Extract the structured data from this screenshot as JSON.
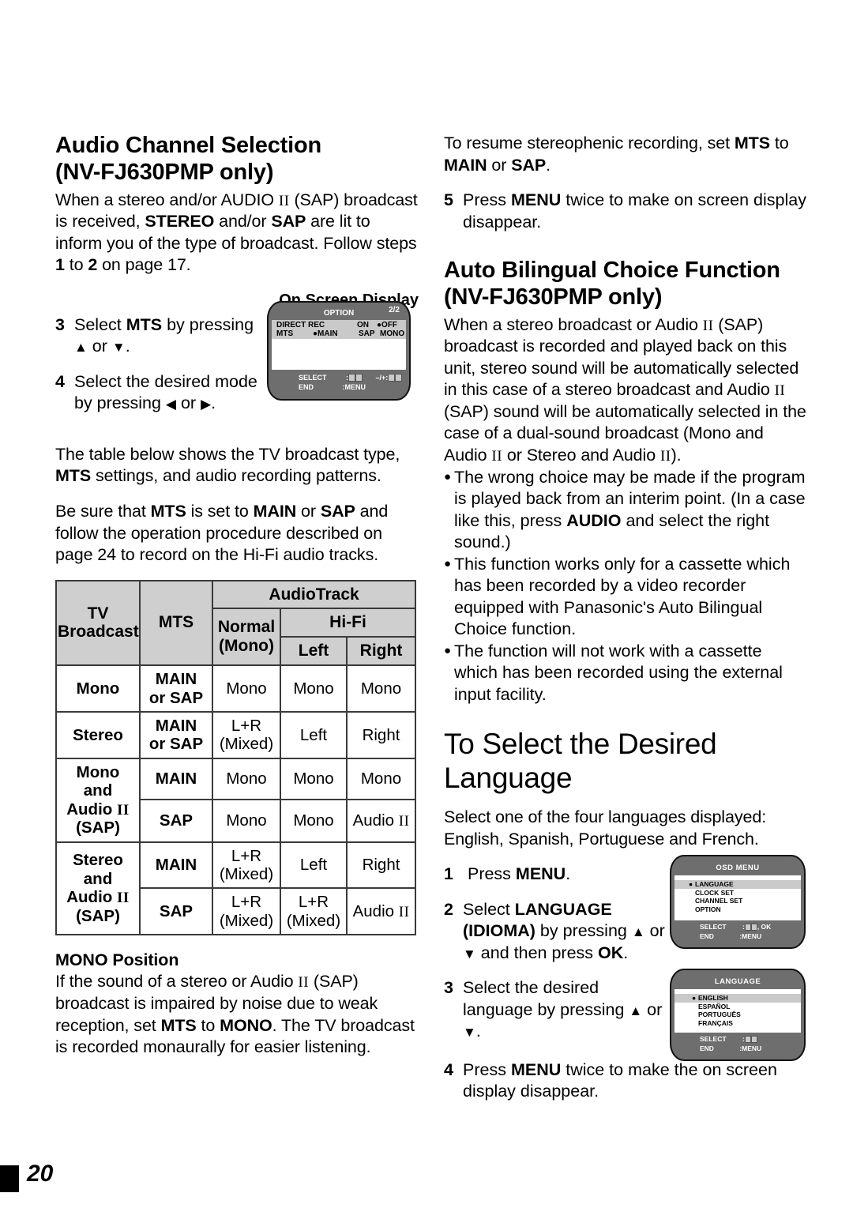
{
  "page": {
    "number": "20"
  },
  "left_column": {
    "heading": {
      "line1": "Audio Channel Selection",
      "line2": "(NV-FJ630PMP only)"
    },
    "intro": "When a stereo and/or AUDIO II (SAP) broadcast is received, STEREO and/or SAP are lit to inform you of the type of broadcast. Follow steps 1 to 2 on page 17.",
    "osd_caption": "On Screen Display",
    "steps": [
      {
        "num": "3",
        "text": "Select MTS by pressing ▲ or ▼."
      },
      {
        "num": "4",
        "text": "Select the desired mode by pressing ◀ or ▶."
      }
    ],
    "para_table_intro": "The table below shows the TV broadcast type, MTS settings, and audio recording patterns.",
    "para_besure": "Be sure that MTS is set to MAIN or SAP and follow the operation procedure described on page 24 to record on the Hi-Fi audio tracks.",
    "mono_position": {
      "heading": "MONO Position",
      "text": "If the sound of a stereo or Audio II (SAP) broadcast is impaired by noise due to weak reception, set MTS to MONO. The TV broadcast is recorded monaurally for easier listening."
    }
  },
  "osd_option": {
    "title": "OPTION",
    "page_indicator": "2/2",
    "row1": {
      "label": "DIRECT REC",
      "opt_on": "ON",
      "opt_off": "OFF",
      "selected": "OFF"
    },
    "row2": {
      "label": "MTS",
      "opt_main": "MAIN",
      "opt_sap": "SAP",
      "opt_mono": "MONO",
      "selected": "MAIN"
    },
    "footer": {
      "select_label": "SELECT",
      "select_value": ":",
      "adjust_label": "–/+:",
      "end_label": "END",
      "end_value": ":MENU"
    }
  },
  "table": {
    "header": {
      "audio_track": "AudioTrack",
      "tv_broadcast_l1": "TV",
      "tv_broadcast_l2": "Broadcast",
      "mts": "MTS",
      "normal_l1": "Normal",
      "normal_l2": "(Mono)",
      "hifi": "Hi-Fi",
      "left": "Left",
      "right": "Right"
    },
    "rows": [
      {
        "broadcast": "Mono",
        "mts_l1": "MAIN",
        "mts_l2": "or SAP",
        "normal_l1": "Mono",
        "normal_l2": "",
        "left_l1": "Mono",
        "left_l2": "",
        "right": "Mono"
      },
      {
        "broadcast": "Stereo",
        "mts_l1": "MAIN",
        "mts_l2": "or SAP",
        "normal_l1": "L+R",
        "normal_l2": "(Mixed)",
        "left_l1": "Left",
        "left_l2": "",
        "right": "Right"
      },
      {
        "broadcast_l1": "Mono",
        "broadcast_l2": "and",
        "broadcast_l3": "Audio II",
        "broadcast_l4": "(SAP)",
        "mts_l1": "MAIN",
        "mts_l2": "",
        "normal_l1": "Mono",
        "normal_l2": "",
        "left_l1": "Mono",
        "left_l2": "",
        "right": "Mono"
      },
      {
        "mts_l1": "SAP",
        "mts_l2": "",
        "normal_l1": "Mono",
        "normal_l2": "",
        "left_l1": "Mono",
        "left_l2": "",
        "right": "Audio II"
      },
      {
        "broadcast_l1": "Stereo",
        "broadcast_l2": "and",
        "broadcast_l3": "Audio II",
        "broadcast_l4": "(SAP)",
        "mts_l1": "MAIN",
        "mts_l2": "",
        "normal_l1": "L+R",
        "normal_l2": "(Mixed)",
        "left_l1": "Left",
        "left_l2": "",
        "right": "Right"
      },
      {
        "mts_l1": "SAP",
        "mts_l2": "",
        "normal_l1": "L+R",
        "normal_l2": "(Mixed)",
        "left_l1": "L+R",
        "left_l2": "(Mixed)",
        "right": "Audio II"
      }
    ]
  },
  "right_column": {
    "resume_text": "To resume stereophenic recording, set MTS to MAIN or SAP.",
    "step5": {
      "num": "5",
      "text": "Press MENU twice to make on screen display disappear."
    },
    "heading_bilingual": {
      "line1": "Auto Bilingual Choice Function",
      "line2": "(NV-FJ630PMP only)"
    },
    "bilingual_text": "When a stereo broadcast or Audio II (SAP) broadcast is recorded and played back on this unit, stereo sound will be automatically selected in this case of a stereo broadcast and Audio II (SAP) sound will be automatically selected in the case of a dual-sound broadcast (Mono and Audio II or Stereo and Audio II).",
    "bullets": [
      "The wrong choice may be made if the program is played back from an interim point. (In a case like this, press AUDIO and select the right sound.)",
      "This function works only for a cassette which has been recorded by a video recorder equipped with Panasonic's Auto Bilingual Choice function.",
      "The function will not work with a cassette which has been recorded using the external input facility."
    ],
    "heading_language": {
      "line1": "To Select the Desired",
      "line2": "Language"
    },
    "language_intro": "Select one of the four languages displayed: English, Spanish, Portuguese and French.",
    "lang_steps": [
      {
        "num": "1",
        "text": "Press MENU."
      },
      {
        "num": "2",
        "text": "Select LANGUAGE (IDIOMA) by pressing ▲ or ▼ and then press OK."
      },
      {
        "num": "3",
        "text": "Select the desired language by pressing ▲ or ▼."
      },
      {
        "num": "4",
        "text": "Press MENU twice to make the on screen display disappear."
      }
    ]
  },
  "osd_menu": {
    "title": "OSD MENU",
    "items": [
      "LANGUAGE",
      "CLOCK SET",
      "CHANNEL SET",
      "OPTION"
    ],
    "selected": "LANGUAGE",
    "footer": {
      "select_label": "SELECT",
      "select_value": ":",
      "ok_text": ", OK",
      "end_label": "END",
      "end_value": ":MENU"
    }
  },
  "osd_language": {
    "title": "LANGUAGE",
    "items": [
      "ENGLISH",
      "ESPAÑOL",
      "PORTUGUÊS",
      "FRANÇAIS"
    ],
    "selected": "ENGLISH",
    "footer": {
      "select_label": "SELECT",
      "select_value": ":",
      "end_label": "END",
      "end_value": ":MENU"
    }
  }
}
